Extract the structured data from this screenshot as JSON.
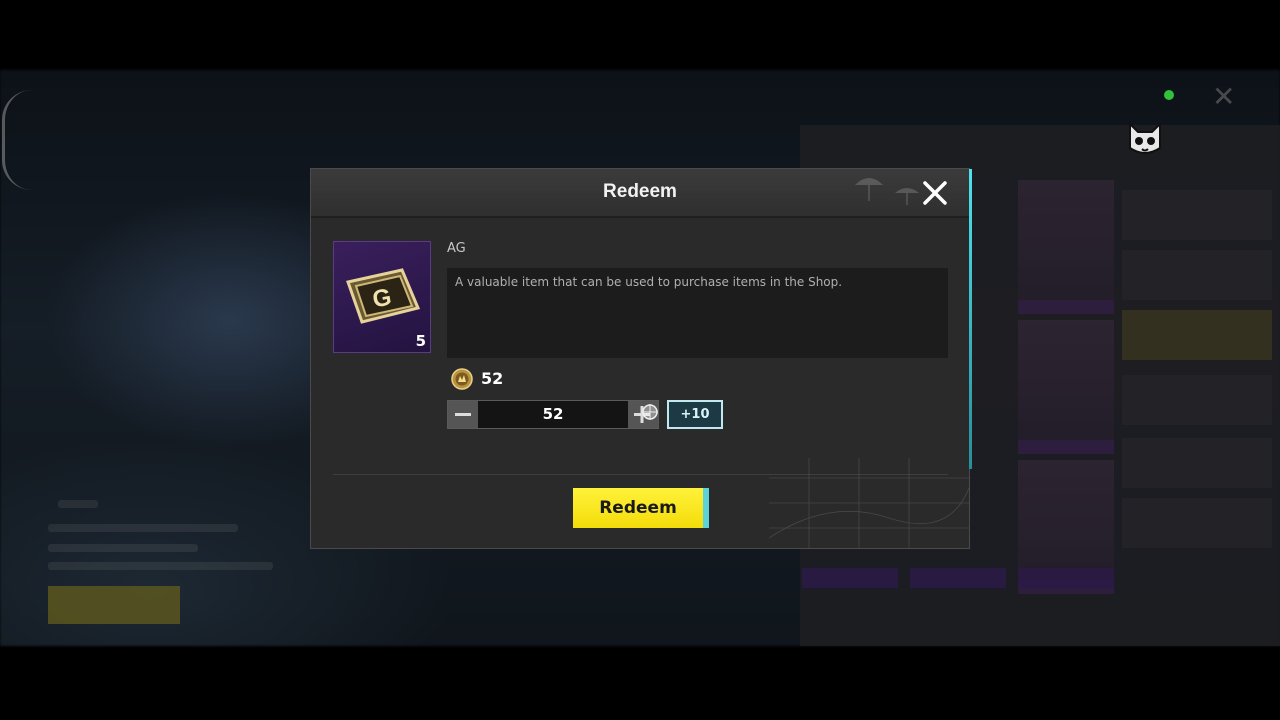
{
  "dialog": {
    "title": "Redeem",
    "item": {
      "name": "AG",
      "count": "5",
      "description": "A valuable item that can be used to purchase items in the Shop."
    },
    "cost": {
      "value": "52"
    },
    "quantity": {
      "value": "52",
      "increment_label": "+10"
    },
    "redeem_label": "Redeem"
  },
  "colors": {
    "accent_yellow": "#f4dc0a",
    "item_frame_purple": "#3a1f5c",
    "dialog_bg": "#2a2a2a",
    "plus10_border": "#bfe9ee"
  },
  "icons": {
    "close": "close-icon",
    "coin": "ag-coin-icon",
    "item": "ag-ticket-icon",
    "minus": "minus-icon",
    "plus": "plus-icon"
  }
}
